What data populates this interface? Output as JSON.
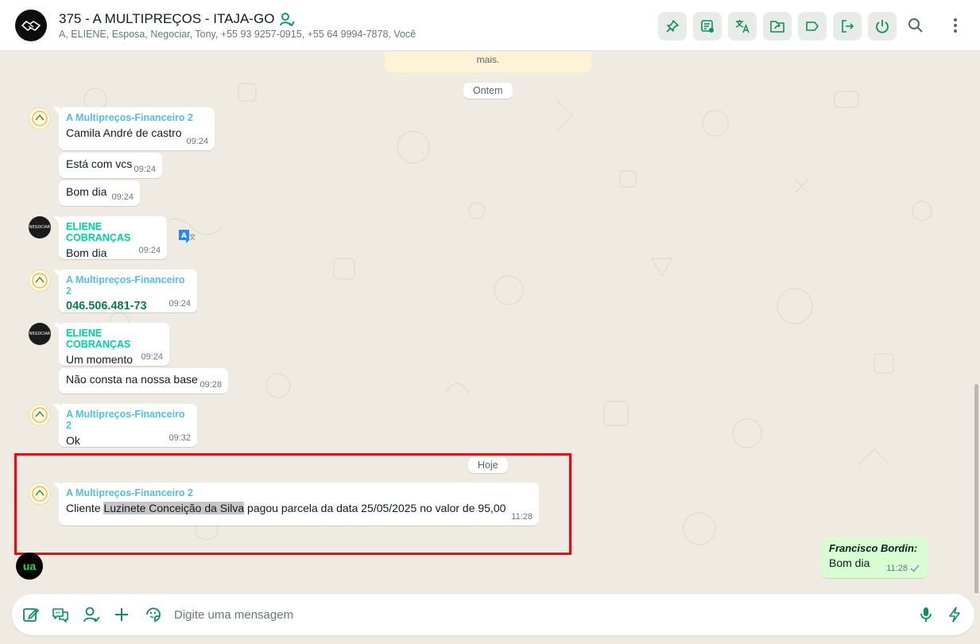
{
  "header": {
    "title": "375 - A MULTIPREÇOS - ITAJA-GO",
    "members": "A, ELIENE, Esposa, Negociar, Tony, +55 93 9257-0915, +55 64 9994-7878, Você",
    "buttons": [
      "pin-icon",
      "chat-note-icon",
      "translate-icon",
      "folder-share-icon",
      "label-icon",
      "exit-icon",
      "power-icon"
    ],
    "accent": "#008069"
  },
  "chat": {
    "system_note": "mais.",
    "date_yesterday": "Ontem",
    "date_today": "Hoje",
    "messages": [
      {
        "sender": "A Multipreços-Financeiro 2",
        "text": "Camila André de castro",
        "time": "09:24"
      },
      {
        "text": "Está com vcs",
        "time": "09:24"
      },
      {
        "text": "Bom dia",
        "time": "09:24"
      },
      {
        "sender": "ELIENE COBRANÇAS",
        "text": "Bom dia",
        "time": "09:24"
      },
      {
        "sender": "A Multipreços-Financeiro 2",
        "text": "046.506.481-73",
        "time": "09:24"
      },
      {
        "sender": "ELIENE COBRANÇAS",
        "text": "Um momento",
        "time": "09:24"
      },
      {
        "text": "Não consta na nossa base",
        "time": "09:28"
      },
      {
        "sender": "A Multipreços-Financeiro 2",
        "text": "Ok",
        "time": "09:32"
      },
      {
        "sender": "A Multipreços-Financeiro 2",
        "text_before": "Cliente ",
        "text_highlight": "Luzinete Conceição da Silva",
        "text_after": " pagou parcela da data 25/05/2025 no valor de 95,00",
        "time": "11:28"
      }
    ],
    "outgoing": {
      "author": "Francisco Bordin:",
      "text": "Bom dia",
      "time": "11:28"
    },
    "fab_label": "ua",
    "avatar_small_text": "NEGOCIAR"
  },
  "composer": {
    "placeholder": "Digite uma mensagem",
    "icons": [
      "edit-icon",
      "chat-bubbles-icon",
      "contact-icon",
      "plus-icon",
      "sticker-icon",
      "mic-icon",
      "lightning-icon"
    ]
  },
  "colors": {
    "sender_blue": "#53bdeb",
    "sender_teal": "#06cf9c",
    "outgoing_bg": "#d9fdd3",
    "highlight_box": "#e01010"
  }
}
